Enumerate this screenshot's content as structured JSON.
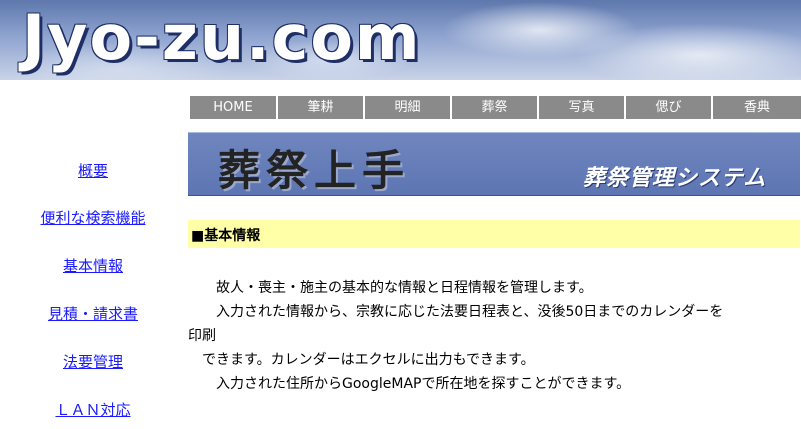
{
  "header": {
    "logo_text": "Jyo-zu.com"
  },
  "nav": {
    "items": [
      "HOME",
      "筆耕",
      "明細",
      "葬祭",
      "写真",
      "偲び",
      "香典"
    ]
  },
  "sidebar": {
    "links": [
      "概要",
      "便利な検索機能",
      "基本情報",
      "見積・請求書",
      "法要管理",
      "ＬＡＮ対応"
    ]
  },
  "banner": {
    "title": "葬祭上手",
    "subtitle": "葬祭管理システム"
  },
  "section": {
    "title": "■基本情報"
  },
  "content": {
    "lines": [
      "　　故人・喪主・施主の基本的な情報と日程情報を管理します。",
      "　　入力された情報から、宗教に応じた法要日程表と、没後50日までのカレンダーを",
      "印刷",
      "　できます。カレンダーはエクセルに出力もできます。",
      "　　入力された住所からGoogleMAPで所在地を探すことができます。"
    ]
  }
}
